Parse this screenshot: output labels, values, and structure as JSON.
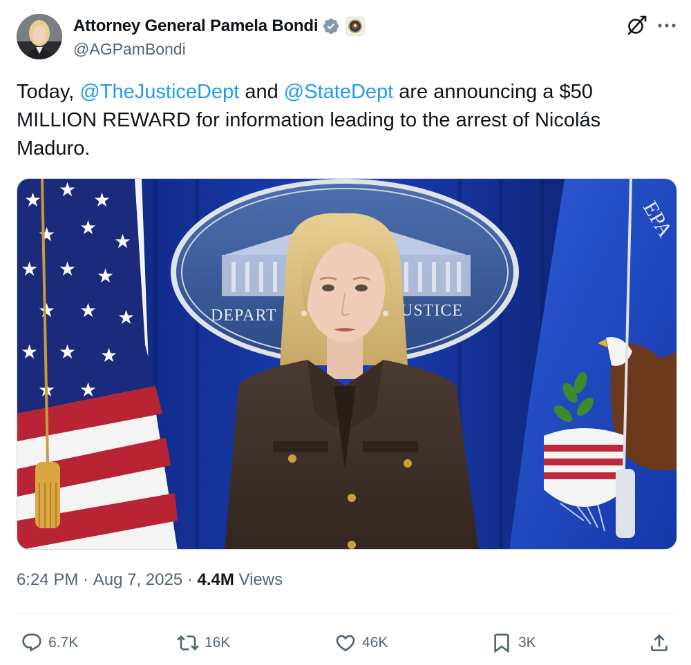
{
  "author": {
    "display_name": "Attorney General Pamela Bondi",
    "handle": "@AGPamBondi",
    "avatar_icon": "profile-photo",
    "verified_icon": "verified-badge-icon",
    "affiliation_icon": "doj-seal-icon"
  },
  "tweet": {
    "text_prefix": "Today, ",
    "mention_1": "@TheJusticeDept",
    "text_mid": " and ",
    "mention_2": "@StateDept",
    "text_suffix": " are announcing a $50 MILLION REWARD for information leading to the arrest of Nicolás Maduro."
  },
  "media": {
    "seal_text_left": "DEPART",
    "seal_text_right": "USTICE",
    "flag_text": "EPA"
  },
  "meta": {
    "time": "6:24 PM",
    "sep": " · ",
    "date": "Aug 7, 2025",
    "sep2": " · ",
    "views_count": "4.4M",
    "views_label": " Views"
  },
  "actions": {
    "replies": "6.7K",
    "reposts": "16K",
    "likes": "46K",
    "bookmarks": "3K"
  },
  "colors": {
    "mention": "#1d9bf0",
    "secondary_text": "#536471",
    "primary_text": "#0f1419",
    "verified": "#1d9bf0"
  }
}
